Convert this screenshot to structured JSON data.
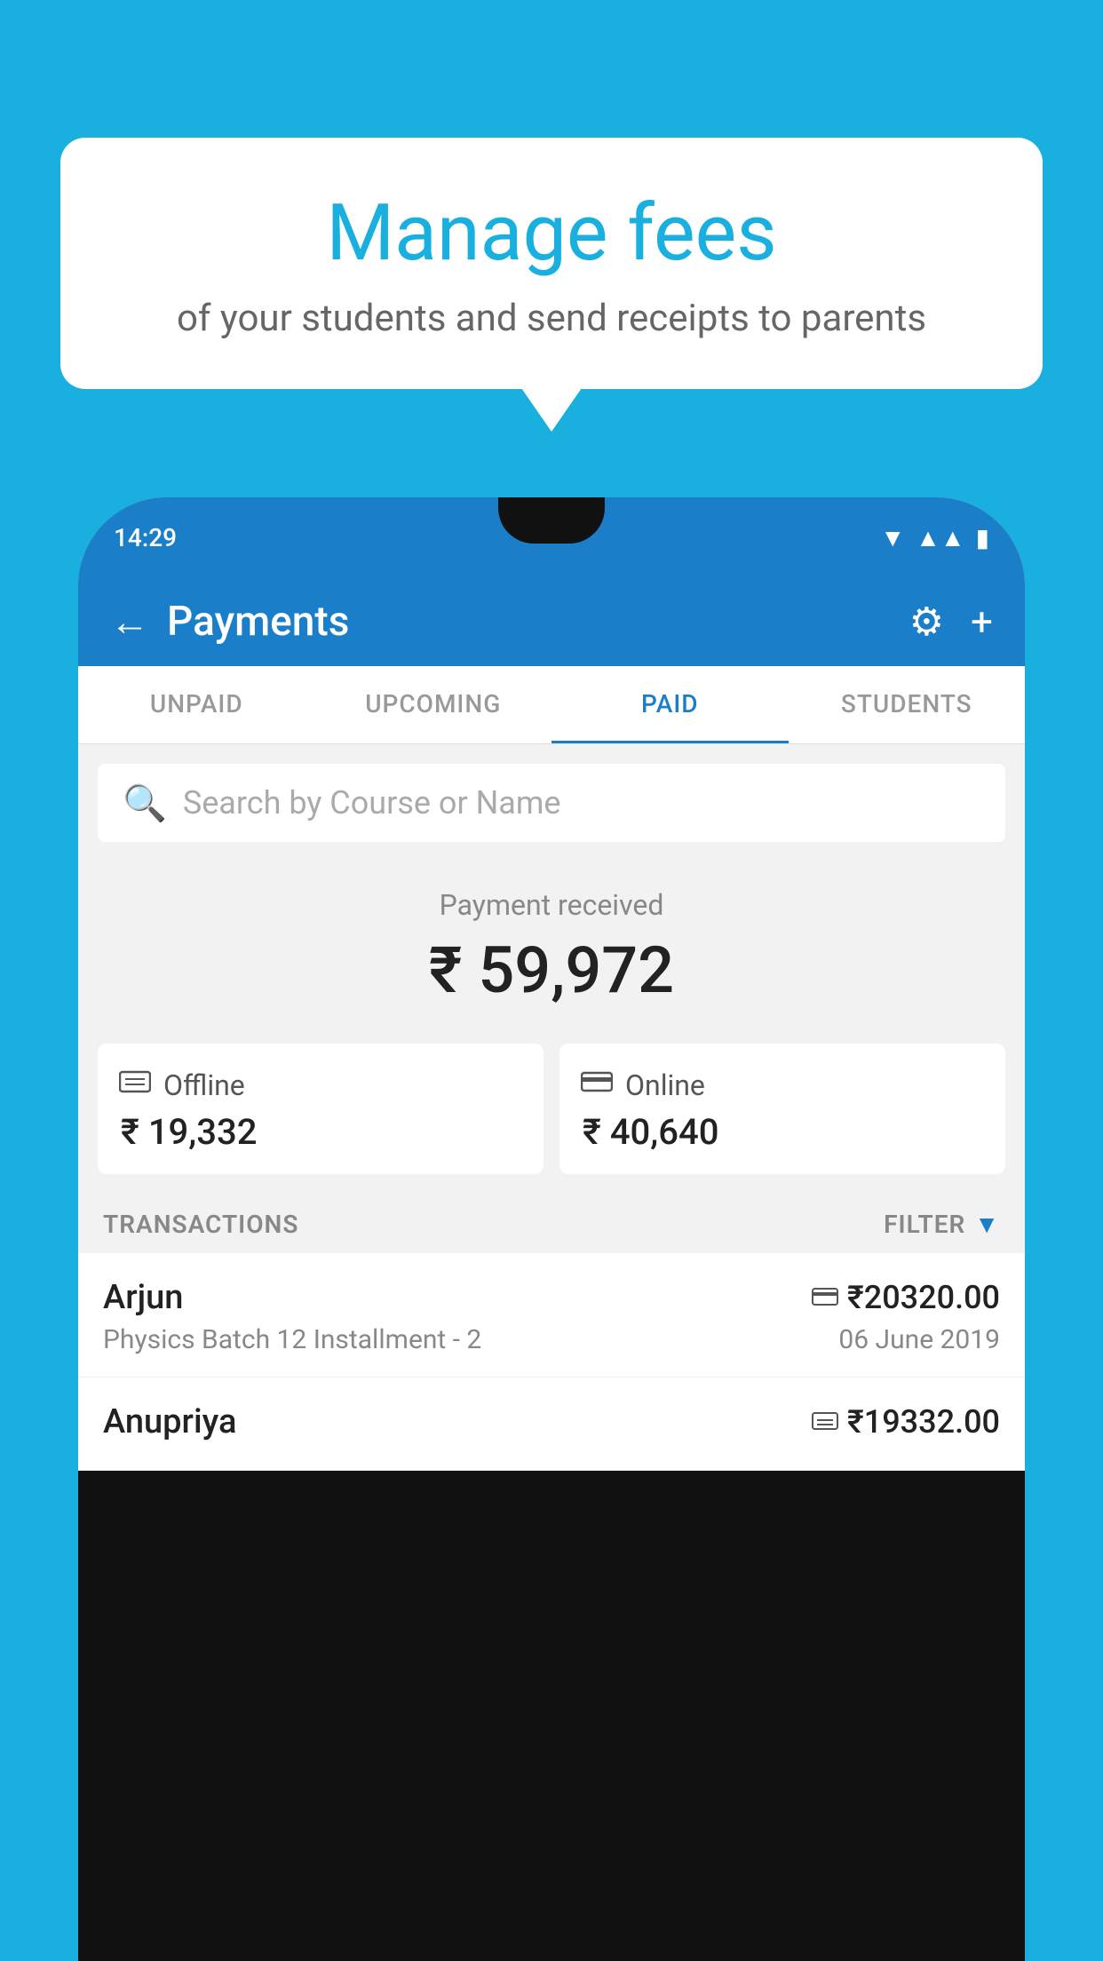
{
  "page": {
    "background_color": "#19B0E0"
  },
  "speech_bubble": {
    "title": "Manage fees",
    "subtitle": "of your students and send receipts to parents"
  },
  "phone": {
    "status_bar": {
      "time": "14:29"
    },
    "header": {
      "title": "Payments",
      "back_label": "←",
      "gear_icon": "⚙",
      "plus_icon": "+"
    },
    "tabs": [
      {
        "label": "UNPAID",
        "active": false
      },
      {
        "label": "UPCOMING",
        "active": false
      },
      {
        "label": "PAID",
        "active": true
      },
      {
        "label": "STUDENTS",
        "active": false
      }
    ],
    "search": {
      "placeholder": "Search by Course or Name"
    },
    "payment_received": {
      "label": "Payment received",
      "amount": "₹ 59,972"
    },
    "payment_cards": [
      {
        "icon": "💳",
        "label": "Offline",
        "amount": "₹ 19,332"
      },
      {
        "icon": "💳",
        "label": "Online",
        "amount": "₹ 40,640"
      }
    ],
    "transactions_section": {
      "label": "TRANSACTIONS",
      "filter_label": "FILTER"
    },
    "transactions": [
      {
        "name": "Arjun",
        "payment_icon": "💳",
        "amount": "₹20320.00",
        "course": "Physics Batch 12 Installment - 2",
        "date": "06 June 2019"
      },
      {
        "name": "Anupriya",
        "payment_icon": "💵",
        "amount": "₹19332.00",
        "course": "",
        "date": ""
      }
    ]
  }
}
